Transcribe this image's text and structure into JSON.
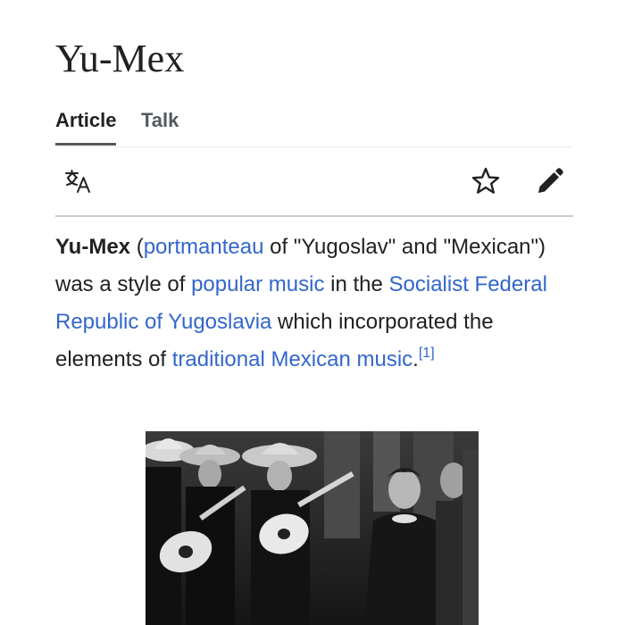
{
  "page": {
    "title": "Yu-Mex"
  },
  "tabs": [
    {
      "label": "Article"
    },
    {
      "label": "Talk"
    }
  ],
  "toolbar": {
    "icons": [
      "translate-icon",
      "star-icon",
      "pencil-icon"
    ]
  },
  "lead": {
    "term": "Yu-Mex",
    "t1": " (",
    "link_portmanteau": "portmanteau",
    "t2": " of \"Yugoslav\" and \"Mexican\") was a style of ",
    "link_popular_music": "popular music",
    "t3": " in the ",
    "link_sfry": "Socialist Federal Republic of Yugoslavia",
    "t4": " which incorporated the elements of ",
    "link_traditional": "traditional Mexican music",
    "t5": ".",
    "ref": "[1]"
  },
  "figure": {
    "description_icon": "photo-mariachi-musicians"
  },
  "colors": {
    "link": "#3366cc",
    "text": "#202122",
    "tab_inactive": "#54595d",
    "divider": "#c8ccd1"
  }
}
